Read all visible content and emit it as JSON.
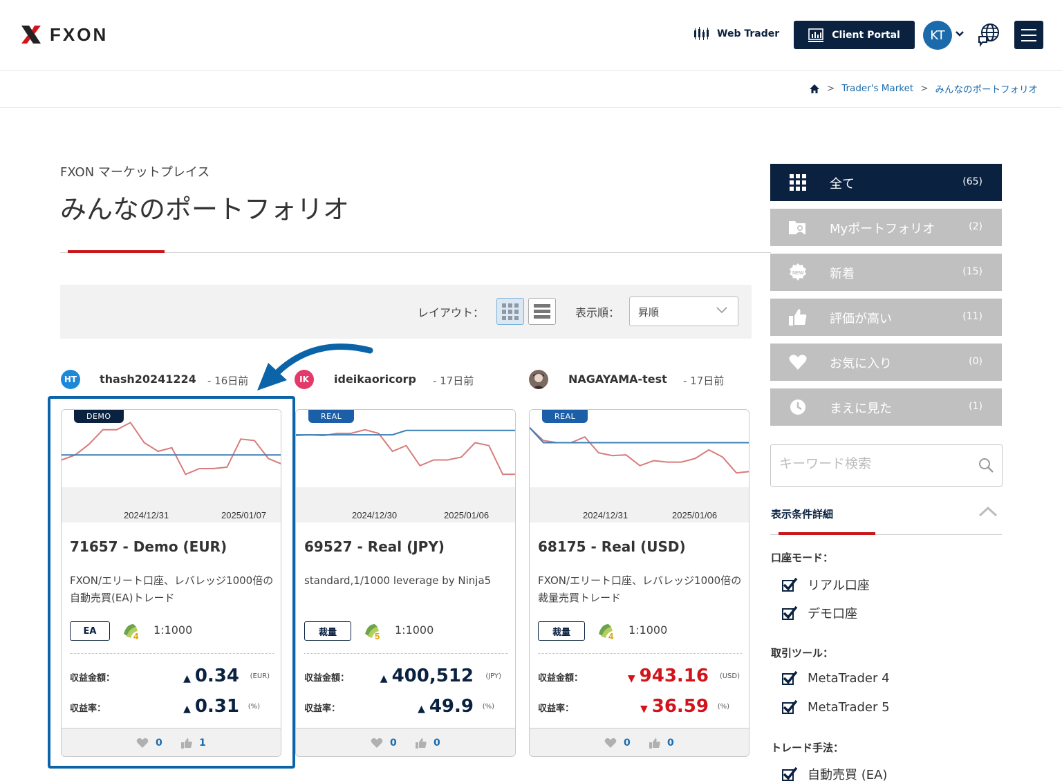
{
  "header": {
    "brand": "FXON",
    "web_trader": "Web Trader",
    "client_portal": "Client Portal",
    "user_initials": "KT"
  },
  "breadcrumb": {
    "items": [
      "Trader's Market",
      "みんなのポートフォリオ"
    ]
  },
  "page": {
    "eyebrow": "FXON マーケットプレイス",
    "title": "みんなのポートフォリオ"
  },
  "toolbar": {
    "layout_label": "レイアウト：",
    "sort_label": "表示順：",
    "sort_value": "昇順"
  },
  "cards": [
    {
      "user": {
        "initials": "HT",
        "name": "thash20241224",
        "time": "- 16日前",
        "color": "#1e88d8"
      },
      "tag": "DEMO",
      "tag_color": "#0a2140",
      "dates": [
        "2024/12/31",
        "2025/01/07"
      ],
      "title": "71657 - Demo (EUR)",
      "desc": "FXON/エリート口座、レバレッジ1000倍の自動売買(EA)トレード",
      "badge": "EA",
      "platform": "MT4",
      "leverage": "1:1000",
      "profit_label": "収益金額：",
      "profit_value": "0.34",
      "profit_unit": "(EUR)",
      "profit_dir": "up",
      "rate_label": "収益率：",
      "rate_value": "0.31",
      "rate_unit": "(%)",
      "rate_dir": "up",
      "likes": "0",
      "thumbs": "1",
      "chart_red": [
        0.62,
        0.55,
        0.4,
        0.2,
        0.2,
        0.1,
        0.38,
        0.5,
        0.45,
        0.82,
        0.74,
        0.74,
        0.72,
        0.33,
        0.35,
        0.6,
        0.68
      ],
      "chart_blue": [
        0.55,
        0.55
      ]
    },
    {
      "user": {
        "initials": "IK",
        "name": "ideikaoricorp",
        "time": "- 17日前",
        "color": "#e23a6b"
      },
      "tag": "REAL",
      "tag_color": "#1b5fa8",
      "dates": [
        "2024/12/30",
        "2025/01/06"
      ],
      "title": "69527 - Real (JPY)",
      "desc": "standard,1/1000 leverage by Ninja5",
      "badge": "裁量",
      "platform": "MT5",
      "leverage": "1:1000",
      "profit_label": "収益金額：",
      "profit_value": "400,512",
      "profit_unit": "(JPY)",
      "profit_dir": "up",
      "rate_label": "収益率：",
      "rate_value": "49.9",
      "rate_unit": "(%)",
      "rate_dir": "up",
      "likes": "0",
      "thumbs": "0",
      "chart_red": [
        0.28,
        0.27,
        0.28,
        0.25,
        0.25,
        0.2,
        0.25,
        0.5,
        0.42,
        0.7,
        0.62,
        0.62,
        0.58,
        0.38,
        0.42,
        0.82,
        0.82
      ],
      "chart_blue": [
        0.27,
        0.27,
        0.27,
        0.27,
        0.27,
        0.27,
        0.27,
        0.27,
        0.21,
        0.21,
        0.21,
        0.21,
        0.21,
        0.21,
        0.21,
        0.21,
        0.21
      ]
    },
    {
      "user": {
        "initials": "",
        "name": "NAGAYAMA-test",
        "time": "- 17日前",
        "color": "#6b5347"
      },
      "tag": "REAL",
      "tag_color": "#1b5fa8",
      "dates": [
        "2024/12/31",
        "2025/01/06"
      ],
      "title": "68175 - Real (USD)",
      "desc": "FXON/エリート口座、レバレッジ1000倍の裁量売買トレード",
      "badge": "裁量",
      "platform": "MT4",
      "leverage": "1:1000",
      "profit_label": "収益金額：",
      "profit_value": "943.16",
      "profit_unit": "(USD)",
      "profit_dir": "down",
      "rate_label": "収益率：",
      "rate_value": "36.59",
      "rate_unit": "(%)",
      "rate_dir": "down",
      "likes": "0",
      "thumbs": "0",
      "chart_red": [
        0.17,
        0.35,
        0.38,
        0.38,
        0.3,
        0.52,
        0.56,
        0.55,
        0.7,
        0.63,
        0.65,
        0.65,
        0.6,
        0.48,
        0.58,
        0.8,
        0.78
      ],
      "chart_blue": [
        0.17,
        0.38,
        0.38,
        0.38,
        0.38,
        0.38,
        0.38,
        0.38,
        0.38,
        0.38,
        0.38,
        0.38,
        0.38,
        0.38,
        0.38,
        0.38,
        0.38
      ]
    }
  ],
  "sidebar": {
    "items": [
      {
        "label": "全て",
        "count": "(65)",
        "icon": "grid-icon"
      },
      {
        "label": "Myポートフォリオ",
        "count": "(2)",
        "icon": "folder-user-icon"
      },
      {
        "label": "新着",
        "count": "(15)",
        "icon": "new-badge-icon"
      },
      {
        "label": "評価が高い",
        "count": "(11)",
        "icon": "thumbs-up-icon"
      },
      {
        "label": "お気に入り",
        "count": "(0)",
        "icon": "heart-icon"
      },
      {
        "label": "まえに見た",
        "count": "(1)",
        "icon": "clock-icon"
      }
    ],
    "search_placeholder": "キーワード検索",
    "filter_title": "表示条件詳細",
    "groups": [
      {
        "label": "口座モード：",
        "options": [
          "リアル口座",
          "デモ口座"
        ]
      },
      {
        "label": "取引ツール：",
        "options": [
          "MetaTrader 4",
          "MetaTrader 5"
        ]
      },
      {
        "label": "トレード手法：",
        "options": [
          "自動売買 (EA)"
        ]
      }
    ]
  },
  "colors": {
    "navy": "#0a2140",
    "accent_red": "#c8161d",
    "link_blue": "#1b6aac",
    "chart_red": "#d87b7b",
    "chart_blue": "#3a7fb5",
    "highlight": "#0b63a8"
  }
}
